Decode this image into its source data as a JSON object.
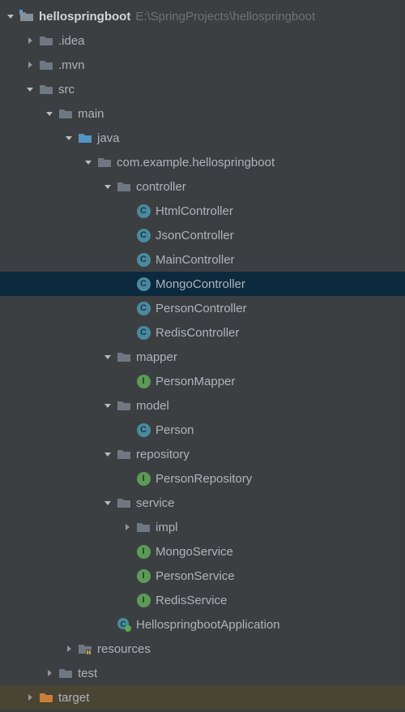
{
  "project_name": "hellospringboot",
  "project_path": "E:\\SpringProjects\\hellospringboot",
  "rows": [
    {
      "indent": 0,
      "arrow": "down",
      "icon": "project-root",
      "label": "hellospringboot",
      "bold": true,
      "suffix_key": "project_path"
    },
    {
      "indent": 1,
      "arrow": "right",
      "icon": "folder-dark",
      "label": ".idea"
    },
    {
      "indent": 1,
      "arrow": "right",
      "icon": "folder-dark",
      "label": ".mvn"
    },
    {
      "indent": 1,
      "arrow": "down",
      "icon": "folder-dark",
      "label": "src"
    },
    {
      "indent": 2,
      "arrow": "down",
      "icon": "folder-dark",
      "label": "main"
    },
    {
      "indent": 3,
      "arrow": "down",
      "icon": "folder-blue",
      "label": "java"
    },
    {
      "indent": 4,
      "arrow": "down",
      "icon": "folder-dark",
      "label": "com.example.hellospringboot"
    },
    {
      "indent": 5,
      "arrow": "down",
      "icon": "folder-dark",
      "label": "controller"
    },
    {
      "indent": 6,
      "arrow": "none",
      "icon": "class",
      "label": "HtmlController"
    },
    {
      "indent": 6,
      "arrow": "none",
      "icon": "class",
      "label": "JsonController"
    },
    {
      "indent": 6,
      "arrow": "none",
      "icon": "class",
      "label": "MainController"
    },
    {
      "indent": 6,
      "arrow": "none",
      "icon": "class",
      "label": "MongoController",
      "selected": true
    },
    {
      "indent": 6,
      "arrow": "none",
      "icon": "class",
      "label": "PersonController"
    },
    {
      "indent": 6,
      "arrow": "none",
      "icon": "class",
      "label": "RedisController"
    },
    {
      "indent": 5,
      "arrow": "down",
      "icon": "folder-dark",
      "label": "mapper"
    },
    {
      "indent": 6,
      "arrow": "none",
      "icon": "interface",
      "label": "PersonMapper"
    },
    {
      "indent": 5,
      "arrow": "down",
      "icon": "folder-dark",
      "label": "model"
    },
    {
      "indent": 6,
      "arrow": "none",
      "icon": "class",
      "label": "Person"
    },
    {
      "indent": 5,
      "arrow": "down",
      "icon": "folder-dark",
      "label": "repository"
    },
    {
      "indent": 6,
      "arrow": "none",
      "icon": "interface",
      "label": "PersonRepository"
    },
    {
      "indent": 5,
      "arrow": "down",
      "icon": "folder-dark",
      "label": "service"
    },
    {
      "indent": 6,
      "arrow": "right",
      "icon": "folder-dark",
      "label": "impl"
    },
    {
      "indent": 6,
      "arrow": "none",
      "icon": "interface",
      "label": "MongoService"
    },
    {
      "indent": 6,
      "arrow": "none",
      "icon": "interface",
      "label": "PersonService"
    },
    {
      "indent": 6,
      "arrow": "none",
      "icon": "interface",
      "label": "RedisService"
    },
    {
      "indent": 5,
      "arrow": "none",
      "icon": "spring-app",
      "label": "HellospringbootApplication"
    },
    {
      "indent": 3,
      "arrow": "right",
      "icon": "resources",
      "label": "resources"
    },
    {
      "indent": 2,
      "arrow": "right",
      "icon": "folder-dark",
      "label": "test"
    },
    {
      "indent": 1,
      "arrow": "right",
      "icon": "folder-orange",
      "label": "target",
      "highlighted": true
    }
  ],
  "icon_letters": {
    "class": "C",
    "interface": "I"
  }
}
